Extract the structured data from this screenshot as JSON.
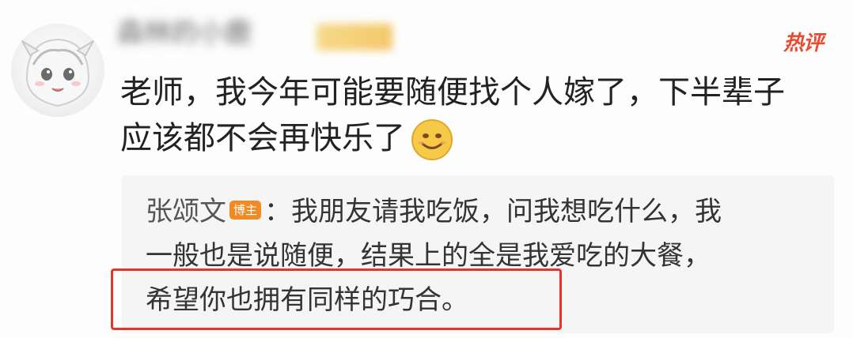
{
  "post": {
    "username": "森林的小鹿",
    "user_badge": "",
    "hot_tag": "热评",
    "comment_line1": "老师，我今年可能要随便找个人嫁了，下半辈子",
    "comment_line2": "应该都不会再快乐了",
    "emoji_icon": "smiley-face-icon"
  },
  "reply": {
    "author": "张颂文",
    "author_badge": "博主",
    "line1": "：我朋友请我吃饭，问我想吃什么，我",
    "line2": "一般也是说随便，结果上的全是我爱吃的大餐，",
    "line3": "希望你也拥有同样的巧合。"
  },
  "colors": {
    "highlight": "#e8332a",
    "hot_tag": "#e84b2f",
    "badge": "#f08a24"
  }
}
